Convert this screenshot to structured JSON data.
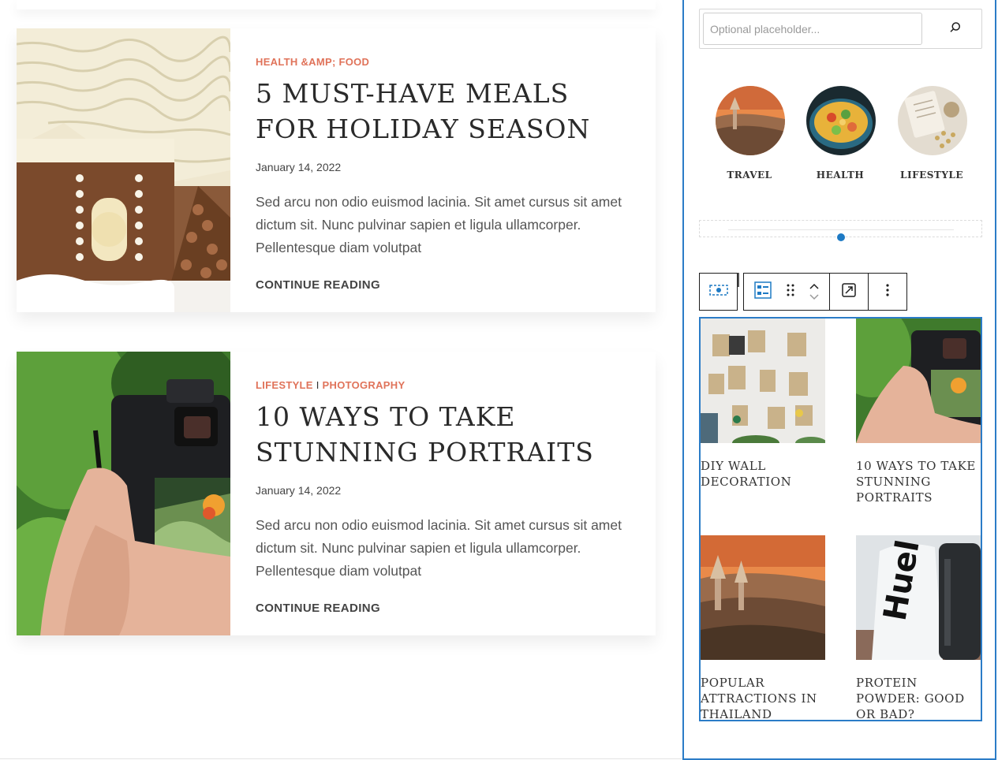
{
  "posts": [
    {
      "category": "HEALTH &AMP; FOOD",
      "title": "5 MUST-HAVE MEALS FOR HOLIDAY SEASON",
      "date": "January 14, 2022",
      "excerpt": "Sed arcu non odio euismod lacinia. Sit amet cursus sit amet dictum sit. Nunc pulvinar sapien et ligula ullamcorper. Pellentesque diam volutpat",
      "cta": "CONTINUE READING"
    },
    {
      "category_1": "LIFESTYLE",
      "category_sep": "I",
      "category_2": "PHOTOGRAPHY",
      "title": "10 WAYS TO TAKE STUNNING PORTRAITS",
      "date": "January 14, 2022",
      "excerpt": "Sed arcu non odio euismod lacinia. Sit amet cursus sit amet dictum sit. Nunc pulvinar sapien et ligula ullamcorper. Pellentesque diam volutpat",
      "cta": "CONTINUE READING"
    }
  ],
  "sidebar": {
    "search": {
      "placeholder": "Optional placeholder...",
      "value": "",
      "icon": "search-icon"
    },
    "categories": [
      "TRAVEL",
      "HEALTH",
      "LIFESTYLE"
    ],
    "toolbar": {
      "icons": [
        "block-select-icon",
        "list-view-icon",
        "drag-handle-icon",
        "move-up-icon",
        "move-down-icon",
        "transform-icon",
        "more-options-icon"
      ]
    },
    "grid_posts": [
      "DIY WALL DECORATION",
      "10 WAYS TO TAKE STUNNING PORTRAITS",
      "POPULAR ATTRACTIONS IN THAILAND",
      "PROTEIN POWDER: GOOD OR BAD?"
    ]
  },
  "colors": {
    "accent": "#e0735a",
    "editor_blue": "#2b7cc7",
    "slider_dot": "#1d7ac4"
  }
}
